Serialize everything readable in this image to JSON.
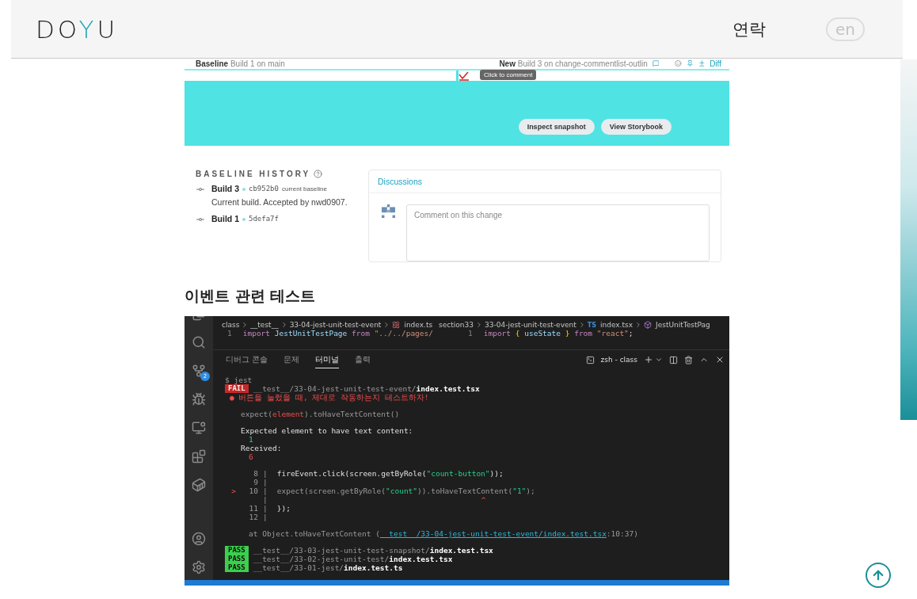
{
  "header": {
    "logo": [
      {
        "text": "DO",
        "accent": false
      },
      {
        "text": "Y",
        "accent": true
      },
      {
        "text": "U",
        "accent": false
      }
    ],
    "nav": "연락",
    "lang": "en"
  },
  "review": {
    "baseline_label": "Baseline",
    "baseline_text": "Build 1 on main",
    "new_label": "New",
    "new_text": "Build 3 on change-commentlist-outlin",
    "diff": "Diff",
    "tooltip": "Click to comment",
    "buttons": [
      "Inspect snapshot",
      "View Storybook"
    ],
    "history_title": "BASELINE HISTORY",
    "builds": [
      {
        "name": "Build 3",
        "hash": "cb952b0",
        "note": "current baseline",
        "desc": "Current build. Accepted by nwd0907."
      },
      {
        "name": "Build 1",
        "hash": "5defa7f"
      }
    ],
    "discussions": "Discussions",
    "comment_placeholder": "Comment on this change"
  },
  "heading": "이벤트 관련 테스트",
  "editor": {
    "scm_badge": "2",
    "breadcrumbs_left": [
      {
        "text": "class"
      },
      {
        "text": "__test__"
      },
      {
        "text": "33-04-jest-unit-test-event"
      },
      {
        "text": "index.ts",
        "kind": "react"
      }
    ],
    "breadcrumbs_right": [
      {
        "text": "section33"
      },
      {
        "text": "33-04-jest-unit-test-event"
      },
      {
        "text": "index.tsx",
        "kind": "typescript",
        "badge": "TS"
      },
      {
        "text": "JestUnitTestPag",
        "kind": "component"
      }
    ],
    "code_left": [
      {
        "num": "1",
        "parts": [
          {
            "text": "import ",
            "kind": "keyword"
          },
          {
            "text": "JestUnitTestPage ",
            "kind": "ident"
          },
          {
            "text": "from ",
            "kind": "keyword"
          },
          {
            "text": "\"../../pages/",
            "kind": "string"
          }
        ]
      }
    ],
    "code_right": [
      {
        "num": "1",
        "parts": [
          {
            "text": "import ",
            "kind": "keyword"
          },
          {
            "text": "{ ",
            "kind": "brace"
          },
          {
            "text": "useState ",
            "kind": "ident"
          },
          {
            "text": "} ",
            "kind": "brace"
          },
          {
            "text": "from ",
            "kind": "keyword"
          },
          {
            "text": "\"react\"",
            "kind": "string"
          },
          {
            "text": ";",
            "kind": "plain"
          }
        ]
      }
    ],
    "panel_tabs": [
      {
        "label": "디버그 콘솔",
        "selected": false
      },
      {
        "label": "문제",
        "selected": false
      },
      {
        "label": "터미널",
        "selected": true
      },
      {
        "label": "출력",
        "selected": false
      }
    ],
    "terminal_name": "zsh - class",
    "terminal": [
      [
        {
          "kind": "prompt",
          "parts": [
            {
              "text": "$ jest",
              "kind": "dim"
            }
          ]
        },
        {
          "kind": "result",
          "badge": {
            "text": "FAIL",
            "kind": "fail"
          },
          "parts": [
            {
              "text": "__test__/33-04-jest-unit-test-event/",
              "kind": "dim"
            },
            {
              "text": "index.test.tsx",
              "kind": "file"
            }
          ]
        },
        {
          "kind": "title",
          "parts": [
            {
              "text": "● 버튼을 눌렀을 때, 제대로 작동하는지 테스트하자!",
              "kind": "error"
            }
          ]
        }
      ],
      [
        {
          "kind": "message",
          "parts": [
            {
              "text": "expect(",
              "kind": "dim"
            },
            {
              "text": "element",
              "kind": "error"
            },
            {
              "text": ").toHaveTextContent()",
              "kind": "dim"
            }
          ]
        }
      ],
      [
        {
          "kind": "message",
          "parts": [
            {
              "text": "Expected element to have text content:",
              "kind": "plain"
            }
          ]
        },
        {
          "kind": "value",
          "parts": [
            {
              "text": "1",
              "kind": "expected"
            }
          ]
        },
        {
          "kind": "message",
          "parts": [
            {
              "text": "Received:",
              "kind": "plain"
            }
          ]
        },
        {
          "kind": "value",
          "parts": [
            {
              "text": "6",
              "kind": "error"
            }
          ]
        }
      ],
      [
        {
          "kind": "source",
          "num": "8",
          "bar": "|",
          "parts": [
            {
              "text": "fireEvent.click(screen.getByRole(",
              "kind": "plain"
            },
            {
              "text": "\"count-button\"",
              "kind": "expected"
            },
            {
              "text": "));",
              "kind": "plain"
            }
          ]
        },
        {
          "kind": "source",
          "num": "9",
          "bar": "|"
        },
        {
          "kind": "source",
          "marker": ">",
          "num": "10",
          "bar": "|",
          "parts": [
            {
              "text": "expect(screen.getByRole(",
              "kind": "dim"
            },
            {
              "text": "\"count\"",
              "kind": "expected"
            },
            {
              "text": ")).toHaveTextContent(",
              "kind": "dim"
            },
            {
              "text": "\"1\"",
              "kind": "expected"
            },
            {
              "text": ");",
              "kind": "dim"
            }
          ]
        },
        {
          "kind": "caret",
          "bar": "|",
          "parts": [
            {
              "text": "^",
              "kind": "error"
            }
          ]
        },
        {
          "kind": "source",
          "num": "11",
          "bar": "|",
          "parts": [
            {
              "text": "});",
              "kind": "plain"
            }
          ]
        },
        {
          "kind": "source",
          "num": "12",
          "bar": "|"
        }
      ],
      [
        {
          "kind": "trace",
          "parts": [
            {
              "text": "at Object.toHaveTextContent (",
              "kind": "dim"
            },
            {
              "text": "__test__/33-04-jest-unit-test-event/index.test.tsx",
              "kind": "link"
            },
            {
              "text": ":10:37)",
              "kind": "dim"
            }
          ]
        }
      ],
      [
        {
          "kind": "result",
          "badge": {
            "text": "PASS",
            "kind": "pass"
          },
          "parts": [
            {
              "text": "__test__/33-03-jest-unit-test-snapshot/",
              "kind": "dim"
            },
            {
              "text": "index.test.tsx",
              "kind": "file"
            }
          ]
        },
        {
          "kind": "result",
          "badge": {
            "text": "PASS",
            "kind": "pass"
          },
          "parts": [
            {
              "text": "__test__/33-02-jest-unit-test/",
              "kind": "dim"
            },
            {
              "text": "index.test.tsx",
              "kind": "file"
            }
          ]
        },
        {
          "kind": "result",
          "badge": {
            "text": "PASS",
            "kind": "pass"
          },
          "parts": [
            {
              "text": "__test__/33-01-jest/",
              "kind": "dim"
            },
            {
              "text": "index.test.ts",
              "kind": "file"
            }
          ]
        }
      ]
    ]
  }
}
